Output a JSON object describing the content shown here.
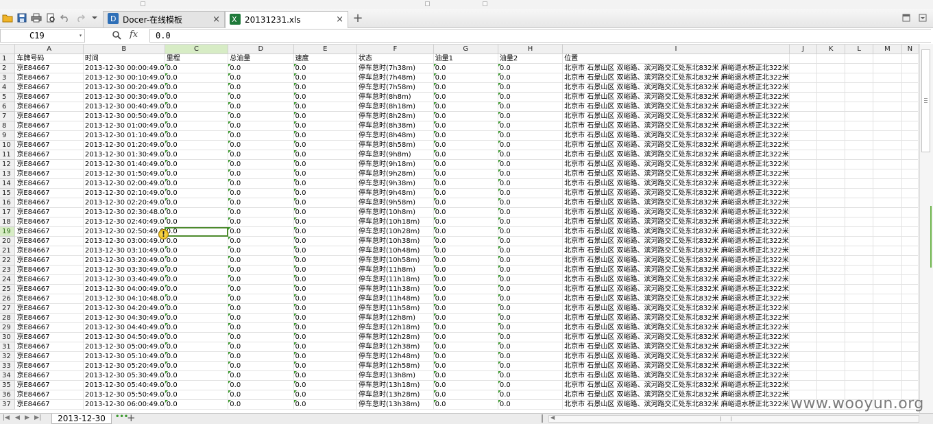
{
  "tabs": [
    {
      "title": "Docer-在线模板",
      "close": "×",
      "icon": "docer-icon"
    },
    {
      "title": "20131231.xls",
      "close": "×",
      "icon": "excel-file-icon"
    }
  ],
  "new_tab": "+",
  "formula_bar": {
    "cell_ref": "C19",
    "fx": "fx",
    "value": "0.0"
  },
  "columns": [
    "A",
    "B",
    "C",
    "D",
    "E",
    "F",
    "G",
    "H",
    "I",
    "J",
    "K",
    "L",
    "M",
    "N"
  ],
  "headers": [
    "车牌号码",
    "时间",
    "里程",
    "总油量",
    "速度",
    "状态",
    "油量1",
    "油量2",
    "位置"
  ],
  "rows": [
    [
      "京E84667",
      "2013-12-30 00:00:49.0",
      "0.0",
      "0.0",
      "0.0",
      "停车怠时(7h38m)",
      "0.0",
      "0.0",
      "北京市 石景山区 双峪路、滨河路交汇处东北832米 麻峪退水桥正北322米"
    ],
    [
      "京E84667",
      "2013-12-30 00:10:49.0",
      "0.0",
      "0.0",
      "0.0",
      "停车怠时(7h48m)",
      "0.0",
      "0.0",
      "北京市 石景山区 双峪路、滨河路交汇处东北832米 麻峪退水桥正北322米"
    ],
    [
      "京E84667",
      "2013-12-30 00:20:49.0",
      "0.0",
      "0.0",
      "0.0",
      "停车怠时(7h58m)",
      "0.0",
      "0.0",
      "北京市 石景山区 双峪路、滨河路交汇处东北832米 麻峪退水桥正北322米"
    ],
    [
      "京E84667",
      "2013-12-30 00:30:49.0",
      "0.0",
      "0.0",
      "0.0",
      "停车怠时(8h8m)",
      "0.0",
      "0.0",
      "北京市 石景山区 双峪路、滨河路交汇处东北832米 麻峪退水桥正北322米"
    ],
    [
      "京E84667",
      "2013-12-30 00:40:49.0",
      "0.0",
      "0.0",
      "0.0",
      "停车怠时(8h18m)",
      "0.0",
      "0.0",
      "北京市 石景山区 双峪路、滨河路交汇处东北832米 麻峪退水桥正北322米"
    ],
    [
      "京E84667",
      "2013-12-30 00:50:49.0",
      "0.0",
      "0.0",
      "0.0",
      "停车怠时(8h28m)",
      "0.0",
      "0.0",
      "北京市 石景山区 双峪路、滨河路交汇处东北832米 麻峪退水桥正北322米"
    ],
    [
      "京E84667",
      "2013-12-30 01:00:49.0",
      "0.0",
      "0.0",
      "0.0",
      "停车怠时(8h38m)",
      "0.0",
      "0.0",
      "北京市 石景山区 双峪路、滨河路交汇处东北832米 麻峪退水桥正北322米"
    ],
    [
      "京E84667",
      "2013-12-30 01:10:49.0",
      "0.0",
      "0.0",
      "0.0",
      "停车怠时(8h48m)",
      "0.0",
      "0.0",
      "北京市 石景山区 双峪路、滨河路交汇处东北832米 麻峪退水桥正北322米"
    ],
    [
      "京E84667",
      "2013-12-30 01:20:49.0",
      "0.0",
      "0.0",
      "0.0",
      "停车怠时(8h58m)",
      "0.0",
      "0.0",
      "北京市 石景山区 双峪路、滨河路交汇处东北832米 麻峪退水桥正北322米"
    ],
    [
      "京E84667",
      "2013-12-30 01:30:49.0",
      "0.0",
      "0.0",
      "0.0",
      "停车怠时(9h8m)",
      "0.0",
      "0.0",
      "北京市 石景山区 双峪路、滨河路交汇处东北832米 麻峪退水桥正北322米"
    ],
    [
      "京E84667",
      "2013-12-30 01:40:49.0",
      "0.0",
      "0.0",
      "0.0",
      "停车怠时(9h18m)",
      "0.0",
      "0.0",
      "北京市 石景山区 双峪路、滨河路交汇处东北832米 麻峪退水桥正北322米"
    ],
    [
      "京E84667",
      "2013-12-30 01:50:49.0",
      "0.0",
      "0.0",
      "0.0",
      "停车怠时(9h28m)",
      "0.0",
      "0.0",
      "北京市 石景山区 双峪路、滨河路交汇处东北832米 麻峪退水桥正北322米"
    ],
    [
      "京E84667",
      "2013-12-30 02:00:49.0",
      "0.0",
      "0.0",
      "0.0",
      "停车怠时(9h38m)",
      "0.0",
      "0.0",
      "北京市 石景山区 双峪路、滨河路交汇处东北832米 麻峪退水桥正北322米"
    ],
    [
      "京E84667",
      "2013-12-30 02:10:49.0",
      "0.0",
      "0.0",
      "0.0",
      "停车怠时(9h48m)",
      "0.0",
      "0.0",
      "北京市 石景山区 双峪路、滨河路交汇处东北832米 麻峪退水桥正北322米"
    ],
    [
      "京E84667",
      "2013-12-30 02:20:49.0",
      "0.0",
      "0.0",
      "0.0",
      "停车怠时(9h58m)",
      "0.0",
      "0.0",
      "北京市 石景山区 双峪路、滨河路交汇处东北832米 麻峪退水桥正北322米"
    ],
    [
      "京E84667",
      "2013-12-30 02:30:48.0",
      "0.0",
      "0.0",
      "0.0",
      "停车怠时(10h8m)",
      "0.0",
      "0.0",
      "北京市 石景山区 双峪路、滨河路交汇处东北832米 麻峪退水桥正北322米"
    ],
    [
      "京E84667",
      "2013-12-30 02:40:49.0",
      "0.0",
      "0.0",
      "0.0",
      "停车怠时(10h18m)",
      "0.0",
      "0.0",
      "北京市 石景山区 双峪路、滨河路交汇处东北832米 麻峪退水桥正北322米"
    ],
    [
      "京E84667",
      "2013-12-30 02:50:49.0",
      "0.0",
      "0.0",
      "0.0",
      "停车怠时(10h28m)",
      "0.0",
      "0.0",
      "北京市 石景山区 双峪路、滨河路交汇处东北832米 麻峪退水桥正北322米"
    ],
    [
      "京E84667",
      "2013-12-30 03:00:49.0",
      "0.0",
      "0.0",
      "0.0",
      "停车怠时(10h38m)",
      "0.0",
      "0.0",
      "北京市 石景山区 双峪路、滨河路交汇处东北832米 麻峪退水桥正北322米"
    ],
    [
      "京E84667",
      "2013-12-30 03:10:49.0",
      "0.0",
      "0.0",
      "0.0",
      "停车怠时(10h48m)",
      "0.0",
      "0.0",
      "北京市 石景山区 双峪路、滨河路交汇处东北832米 麻峪退水桥正北322米"
    ],
    [
      "京E84667",
      "2013-12-30 03:20:49.0",
      "0.0",
      "0.0",
      "0.0",
      "停车怠时(10h58m)",
      "0.0",
      "0.0",
      "北京市 石景山区 双峪路、滨河路交汇处东北832米 麻峪退水桥正北322米"
    ],
    [
      "京E84667",
      "2013-12-30 03:30:49.0",
      "0.0",
      "0.0",
      "0.0",
      "停车怠时(11h8m)",
      "0.0",
      "0.0",
      "北京市 石景山区 双峪路、滨河路交汇处东北832米 麻峪退水桥正北322米"
    ],
    [
      "京E84667",
      "2013-12-30 03:40:49.0",
      "0.0",
      "0.0",
      "0.0",
      "停车怠时(11h18m)",
      "0.0",
      "0.0",
      "北京市 石景山区 双峪路、滨河路交汇处东北832米 麻峪退水桥正北322米"
    ],
    [
      "京E84667",
      "2013-12-30 04:00:49.0",
      "0.0",
      "0.0",
      "0.0",
      "停车怠时(11h38m)",
      "0.0",
      "0.0",
      "北京市 石景山区 双峪路、滨河路交汇处东北832米 麻峪退水桥正北322米"
    ],
    [
      "京E84667",
      "2013-12-30 04:10:48.0",
      "0.0",
      "0.0",
      "0.0",
      "停车怠时(11h48m)",
      "0.0",
      "0.0",
      "北京市 石景山区 双峪路、滨河路交汇处东北832米 麻峪退水桥正北322米"
    ],
    [
      "京E84667",
      "2013-12-30 04:20:49.0",
      "0.0",
      "0.0",
      "0.0",
      "停车怠时(11h58m)",
      "0.0",
      "0.0",
      "北京市 石景山区 双峪路、滨河路交汇处东北832米 麻峪退水桥正北322米"
    ],
    [
      "京E84667",
      "2013-12-30 04:30:49.0",
      "0.0",
      "0.0",
      "0.0",
      "停车怠时(12h8m)",
      "0.0",
      "0.0",
      "北京市 石景山区 双峪路、滨河路交汇处东北832米 麻峪退水桥正北322米"
    ],
    [
      "京E84667",
      "2013-12-30 04:40:49.0",
      "0.0",
      "0.0",
      "0.0",
      "停车怠时(12h18m)",
      "0.0",
      "0.0",
      "北京市 石景山区 双峪路、滨河路交汇处东北832米 麻峪退水桥正北322米"
    ],
    [
      "京E84667",
      "2013-12-30 04:50:49.0",
      "0.0",
      "0.0",
      "0.0",
      "停车怠时(12h28m)",
      "0.0",
      "0.0",
      "北京市 石景山区 双峪路、滨河路交汇处东北832米 麻峪退水桥正北322米"
    ],
    [
      "京E84667",
      "2013-12-30 05:00:49.0",
      "0.0",
      "0.0",
      "0.0",
      "停车怠时(12h38m)",
      "0.0",
      "0.0",
      "北京市 石景山区 双峪路、滨河路交汇处东北832米 麻峪退水桥正北322米"
    ],
    [
      "京E84667",
      "2013-12-30 05:10:49.0",
      "0.0",
      "0.0",
      "0.0",
      "停车怠时(12h48m)",
      "0.0",
      "0.0",
      "北京市 石景山区 双峪路、滨河路交汇处东北832米 麻峪退水桥正北322米"
    ],
    [
      "京E84667",
      "2013-12-30 05:20:49.0",
      "0.0",
      "0.0",
      "0.0",
      "停车怠时(12h58m)",
      "0.0",
      "0.0",
      "北京市 石景山区 双峪路、滨河路交汇处东北832米 麻峪退水桥正北322米"
    ],
    [
      "京E84667",
      "2013-12-30 05:30:49.0",
      "0.0",
      "0.0",
      "0.0",
      "停车怠时(13h8m)",
      "0.0",
      "0.0",
      "北京市 石景山区 双峪路、滨河路交汇处东北832米 麻峪退水桥正北322米"
    ],
    [
      "京E84667",
      "2013-12-30 05:40:49.0",
      "0.0",
      "0.0",
      "0.0",
      "停车怠时(13h18m)",
      "0.0",
      "0.0",
      "北京市 石景山区 双峪路、滨河路交汇处东北832米 麻峪退水桥正北322米"
    ],
    [
      "京E84667",
      "2013-12-30 05:50:49.0",
      "0.0",
      "0.0",
      "0.0",
      "停车怠时(13h28m)",
      "0.0",
      "0.0",
      "北京市 石景山区 双峪路、滨河路交汇处东北832米 麻峪退水桥正北322米"
    ],
    [
      "京E84667",
      "2013-12-30 06:00:49.0",
      "0.0",
      "0.0",
      "0.0",
      "停车怠时(13h38m)",
      "0.0",
      "0.0",
      "北京市 石景山区 双峪路、滨河路交汇处东北832米 麻峪退水桥正北322米"
    ]
  ],
  "selected": {
    "row": 19,
    "col": "C"
  },
  "sheet_tab": "2013-12-30",
  "add_sheet": "+",
  "more_sheets": "•••",
  "watermark": "www.wooyun.org",
  "colors": {
    "accent": "#4c8a2c",
    "selection_header": "#d7ecc5",
    "warning": "#e8b400"
  }
}
